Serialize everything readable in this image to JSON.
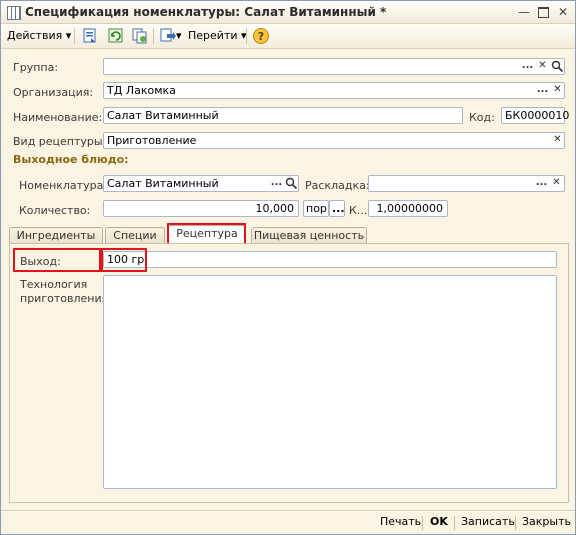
{
  "window": {
    "title": "Спецификация номенклатуры: Салат Витаминный *",
    "min_icon": "minimize-icon",
    "max_icon": "maximize-icon",
    "close_icon": "close-icon"
  },
  "toolbar": {
    "actions_label": "Действия",
    "goto_label": "Перейти",
    "help_label": "?"
  },
  "form": {
    "group": {
      "label": "Группа:",
      "value": ""
    },
    "organization": {
      "label": "Организация:",
      "value": "ТД Лакомка"
    },
    "name": {
      "label": "Наименование:",
      "value": "Салат Витаминный"
    },
    "code": {
      "label": "Код:",
      "value": "БК0000010"
    },
    "recipe_type": {
      "label": "Вид рецептуры:",
      "value": "Приготовление"
    }
  },
  "output_dish": {
    "section_title": "Выходное блюдо:",
    "nomenclature": {
      "label": "Номенклатура:",
      "value": "Салат Витаминный"
    },
    "layout": {
      "label": "Раскладка:",
      "value": ""
    },
    "quantity": {
      "label": "Количество:",
      "value": "10,000",
      "unit": "пор",
      "k_label": "К...",
      "k_value": "1,00000000"
    }
  },
  "tabs": [
    {
      "label": "Ингредиенты"
    },
    {
      "label": "Специи"
    },
    {
      "label": "Рецептура"
    },
    {
      "label": "Пищевая ценность"
    }
  ],
  "recipe_tab": {
    "output": {
      "label": "Выход:",
      "value": "100 гр"
    },
    "technology_label": "Технология приготовления:"
  },
  "footer": {
    "print": "Печать",
    "ok": "OK",
    "save": "Записать",
    "close": "Закрыть"
  },
  "colors": {
    "highlight": "#e3121c",
    "section": "#8a6914",
    "background": "#fbf4e3"
  }
}
